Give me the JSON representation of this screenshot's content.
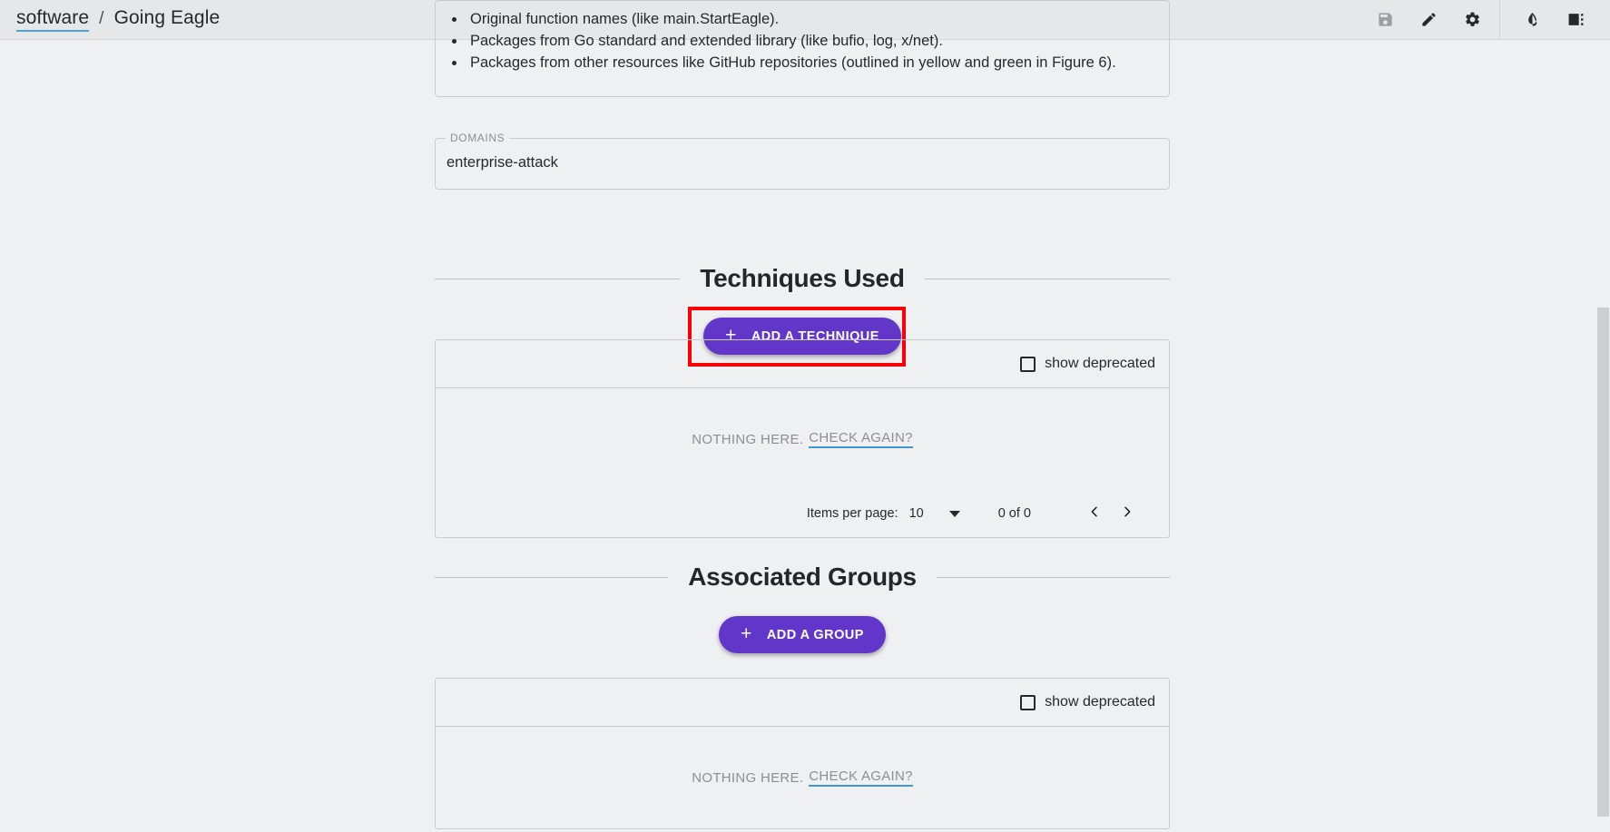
{
  "header": {
    "breadcrumb": {
      "root_label": "software",
      "separator": "/",
      "current_label": "Going Eagle"
    },
    "actions": [
      {
        "name": "save-icon",
        "title": "save",
        "enabled": false
      },
      {
        "name": "edit-icon",
        "title": "edit",
        "enabled": true
      },
      {
        "name": "gear-icon",
        "title": "settings",
        "enabled": true
      },
      {
        "name": "theme-icon",
        "title": "toggle theme",
        "enabled": true
      },
      {
        "name": "layout-icon",
        "title": "toggle sidebar",
        "enabled": true
      }
    ]
  },
  "description_card": {
    "bullets": [
      "Original function names (like main.StartEagle).",
      "Packages from Go standard and extended library (like bufio, log, x/net).",
      "Packages from other resources like GitHub repositories (outlined in yellow and green in Figure 6)."
    ]
  },
  "domains": {
    "legend": "DOMAINS",
    "value": "enterprise-attack"
  },
  "techniques_section": {
    "heading": "Techniques Used",
    "add_button_label": "ADD A TECHNIQUE",
    "add_button_icon": "plus-icon",
    "highlighted": true,
    "show_deprecated_label": "show deprecated",
    "show_deprecated_checked": false,
    "empty_text": "NOTHING HERE.",
    "empty_link": "CHECK AGAIN?",
    "paginator": {
      "items_per_page_label": "Items per page:",
      "items_per_page_value": "10",
      "range_label": "0 of 0",
      "prev_icon": "chevron-left-icon",
      "next_icon": "chevron-right-icon"
    }
  },
  "groups_section": {
    "heading": "Associated Groups",
    "add_button_label": "ADD A GROUP",
    "add_button_icon": "plus-icon",
    "show_deprecated_label": "show deprecated",
    "show_deprecated_checked": false,
    "empty_text": "NOTHING HERE.",
    "empty_link": "CHECK AGAIN?"
  },
  "colors": {
    "accent_purple": "#6236c8",
    "highlight_red": "#fb0007",
    "link_blue": "#3f97d3",
    "page_background": "#eff0f2",
    "header_background": "#e6e7e9"
  }
}
